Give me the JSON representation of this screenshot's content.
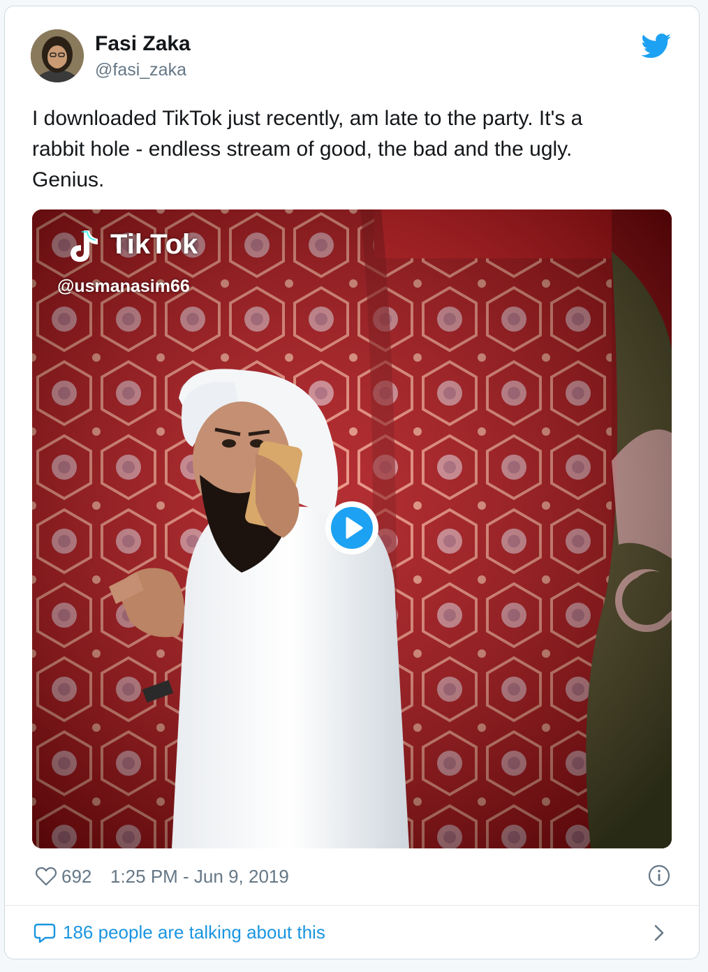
{
  "tweet": {
    "author": {
      "name": "Fasi Zaka",
      "handle": "@fasi_zaka"
    },
    "text": "I downloaded TikTok just recently, am late to the party. It's a\nrabbit hole - endless stream of good, the bad and the ugly.\nGenius.",
    "media": {
      "watermark_brand": "TikTok",
      "watermark_user": "@usmanasim66"
    },
    "likes": "692",
    "timestamp": "1:25 PM - Jun 9, 2019",
    "talking": "186 people are talking about this"
  },
  "colors": {
    "brand_blue": "#1da1f2",
    "link_blue": "#1b95e0",
    "secondary_text": "#657786",
    "border": "#cfd9de"
  },
  "icons": [
    "twitter-bird-icon",
    "heart-icon",
    "info-icon",
    "reply-bubble-icon",
    "chevron-right-icon",
    "play-icon",
    "tiktok-note-icon"
  ]
}
